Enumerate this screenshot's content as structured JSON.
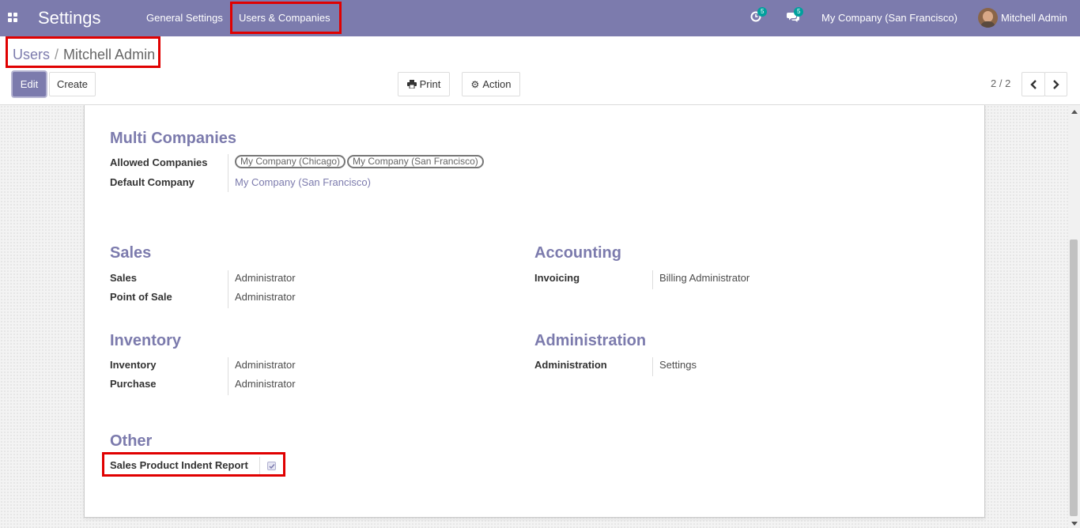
{
  "navbar": {
    "app_title": "Settings",
    "menu": [
      "General Settings",
      "Users & Companies"
    ],
    "activity_count": "5",
    "messages_count": "5",
    "company": "My Company (San Francisco)",
    "user": "Mitchell Admin"
  },
  "breadcrumb": {
    "parent": "Users",
    "separator": "/",
    "current": "Mitchell Admin"
  },
  "buttons": {
    "edit": "Edit",
    "create": "Create",
    "print": "Print",
    "action": "Action"
  },
  "pager": {
    "value": "2 / 2"
  },
  "icons": {
    "apps": "apps-grid-icon",
    "activity": "clock-icon",
    "messages": "chat-icon",
    "print": "printer-icon",
    "action": "gear-icon",
    "prev": "chevron-left-icon",
    "next": "chevron-right-icon"
  },
  "colors": {
    "brand": "#7c7bad",
    "highlight": "#e00000",
    "badge": "#00a09d"
  },
  "form": {
    "multi_companies": {
      "title": "Multi Companies",
      "allowed_label": "Allowed Companies",
      "allowed_tags": [
        "My Company (Chicago)",
        "My Company (San Francisco)"
      ],
      "default_label": "Default Company",
      "default_value": "My Company (San Francisco)"
    },
    "sales": {
      "title": "Sales",
      "rows": [
        {
          "label": "Sales",
          "value": "Administrator"
        },
        {
          "label": "Point of Sale",
          "value": "Administrator"
        }
      ]
    },
    "accounting": {
      "title": "Accounting",
      "rows": [
        {
          "label": "Invoicing",
          "value": "Billing Administrator"
        }
      ]
    },
    "inventory": {
      "title": "Inventory",
      "rows": [
        {
          "label": "Inventory",
          "value": "Administrator"
        },
        {
          "label": "Purchase",
          "value": "Administrator"
        }
      ]
    },
    "administration": {
      "title": "Administration",
      "rows": [
        {
          "label": "Administration",
          "value": "Settings"
        }
      ]
    },
    "other": {
      "title": "Other",
      "rows": [
        {
          "label": "Sales Product Indent Report",
          "checked": true
        }
      ]
    }
  }
}
